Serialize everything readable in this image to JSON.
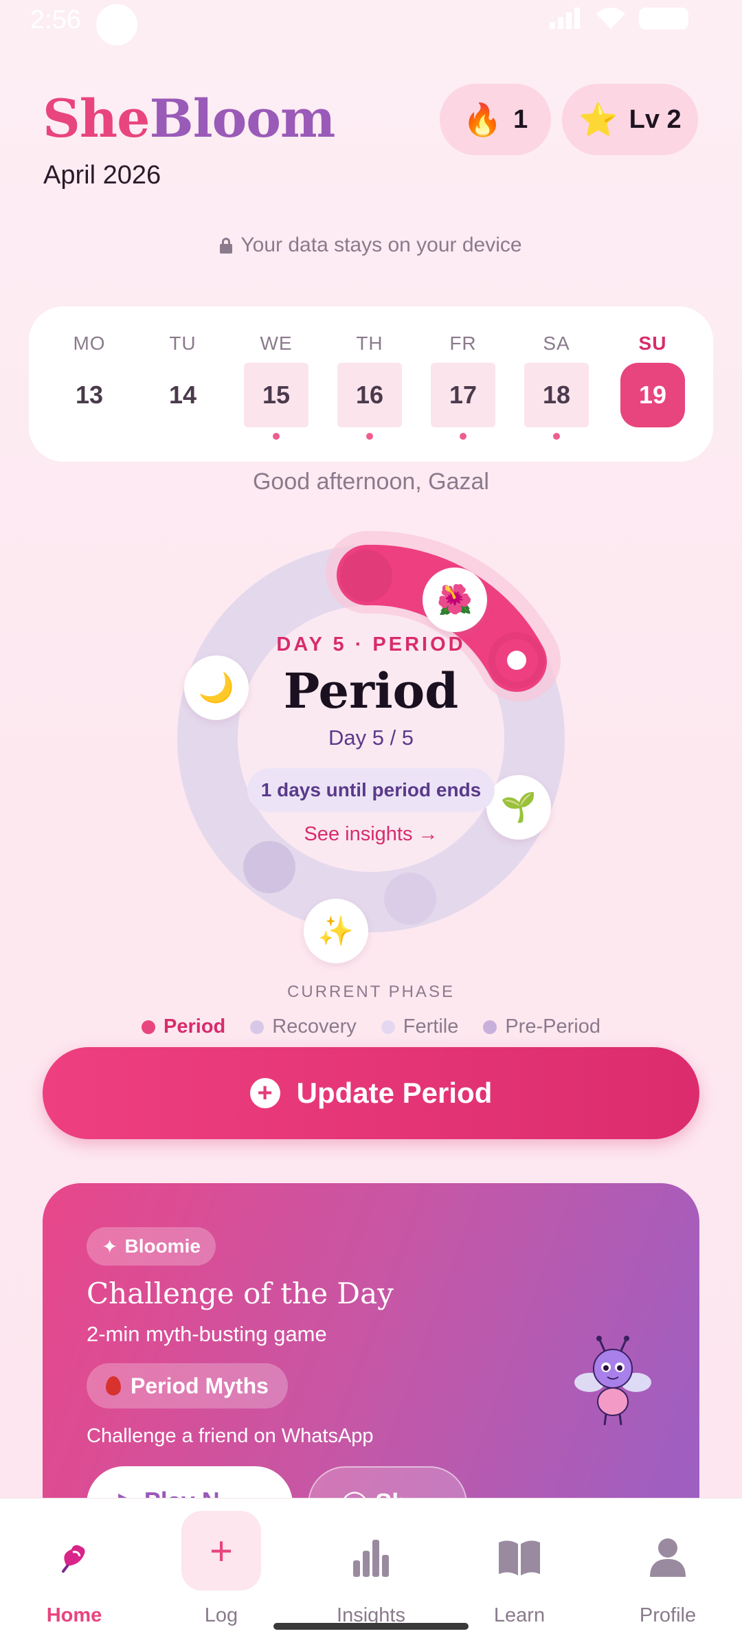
{
  "status_bar": {
    "time": "2:56"
  },
  "header": {
    "logo_she": "She",
    "logo_bloom": "Bloom",
    "month": "April 2026",
    "streak": {
      "icon": "fire-icon",
      "emoji": "🔥",
      "value": "1"
    },
    "level": {
      "icon": "star-icon",
      "emoji": "⭐",
      "value": "Lv 2"
    }
  },
  "privacy_text": "Your data stays on your device",
  "week": {
    "days": [
      {
        "name": "MO",
        "num": "13",
        "state": "normal"
      },
      {
        "name": "TU",
        "num": "14",
        "state": "normal"
      },
      {
        "name": "WE",
        "num": "15",
        "state": "logged"
      },
      {
        "name": "TH",
        "num": "16",
        "state": "logged"
      },
      {
        "name": "FR",
        "num": "17",
        "state": "logged"
      },
      {
        "name": "SA",
        "num": "18",
        "state": "logged"
      },
      {
        "name": "SU",
        "num": "19",
        "state": "today"
      }
    ]
  },
  "greeting": "Good afternoon, Gazal",
  "cycle": {
    "kicker": "DAY 5 · PERIOD",
    "phase": "Period",
    "day_text": "Day 5 / 5",
    "days_left": "1 days until period ends",
    "insights_link": "See insights →",
    "icons": {
      "flower": "🌺",
      "moon": "🌙",
      "sprout": "🌱",
      "sparkles": "✨"
    }
  },
  "current_phase_label": "CURRENT PHASE",
  "legend": [
    {
      "label": "Period",
      "color": "#e8447e",
      "active": true
    },
    {
      "label": "Recovery",
      "color": "#d8c8e8",
      "active": false
    },
    {
      "label": "Fertile",
      "color": "#e4d8f0",
      "active": false
    },
    {
      "label": "Pre-Period",
      "color": "#c8b0dc",
      "active": false
    }
  ],
  "update_button": "Update Period",
  "challenge": {
    "tag": "Bloomie",
    "title": "Challenge of the Day",
    "subtitle": "2-min myth-busting game",
    "chip": "Period Myths",
    "share_text": "Challenge a friend on WhatsApp",
    "play_label": "▶ Play N",
    "share_label": "◯ Sh"
  },
  "nav": [
    {
      "label": "Home",
      "active": true
    },
    {
      "label": "Log",
      "active": false
    },
    {
      "label": "Insights",
      "active": false
    },
    {
      "label": "Learn",
      "active": false
    },
    {
      "label": "Profile",
      "active": false
    }
  ],
  "colors": {
    "brand_pink": "#e8447e",
    "brand_purple": "#9a5ab8",
    "period_arc": "#ee3f80",
    "ring_track": "#e4d8ec"
  }
}
